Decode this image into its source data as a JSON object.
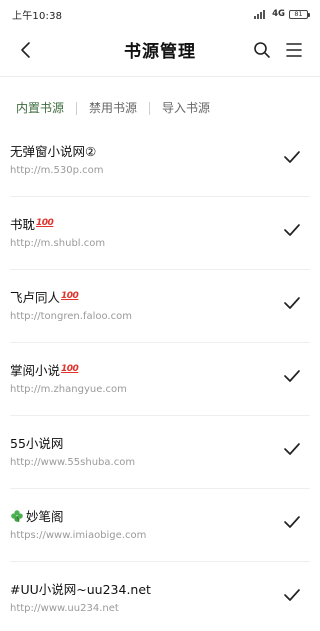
{
  "status_bar": {
    "time": "上午10:38",
    "network": "4G",
    "battery": "81"
  },
  "header": {
    "title": "书源管理",
    "back_icon": "chevron-left-icon",
    "search_icon": "search-icon",
    "menu_icon": "menu-icon"
  },
  "tabs": [
    {
      "label": "内置书源",
      "active": true
    },
    {
      "label": "禁用书源",
      "active": false
    },
    {
      "label": "导入书源",
      "active": false
    }
  ],
  "sources": [
    {
      "name": "无弹窗小说网②",
      "url": "http://m.530p.com",
      "badge": "",
      "leading_icon": "",
      "selected": true
    },
    {
      "name": "书耽",
      "url": "http://m.shubl.com",
      "badge": "100",
      "leading_icon": "",
      "selected": true
    },
    {
      "name": "飞卢同人",
      "url": "http://tongren.faloo.com",
      "badge": "100",
      "leading_icon": "",
      "selected": true
    },
    {
      "name": "掌阅小说",
      "url": "http://m.zhangyue.com",
      "badge": "100",
      "leading_icon": "",
      "selected": true
    },
    {
      "name": "55小说网",
      "url": "http://www.55shuba.com",
      "badge": "",
      "leading_icon": "",
      "selected": true
    },
    {
      "name": "妙笔阁",
      "url": "https://www.imiaobige.com",
      "badge": "",
      "leading_icon": "clover-icon",
      "selected": true
    },
    {
      "name": "#UU小说网~uu234.net",
      "url": "http://www.uu234.net",
      "badge": "",
      "leading_icon": "",
      "selected": true
    }
  ],
  "colors": {
    "active_tab": "#3d6b3d",
    "badge_red": "#e0332b",
    "url_gray": "#9a9a9a",
    "clover_green": "#4caf50"
  }
}
